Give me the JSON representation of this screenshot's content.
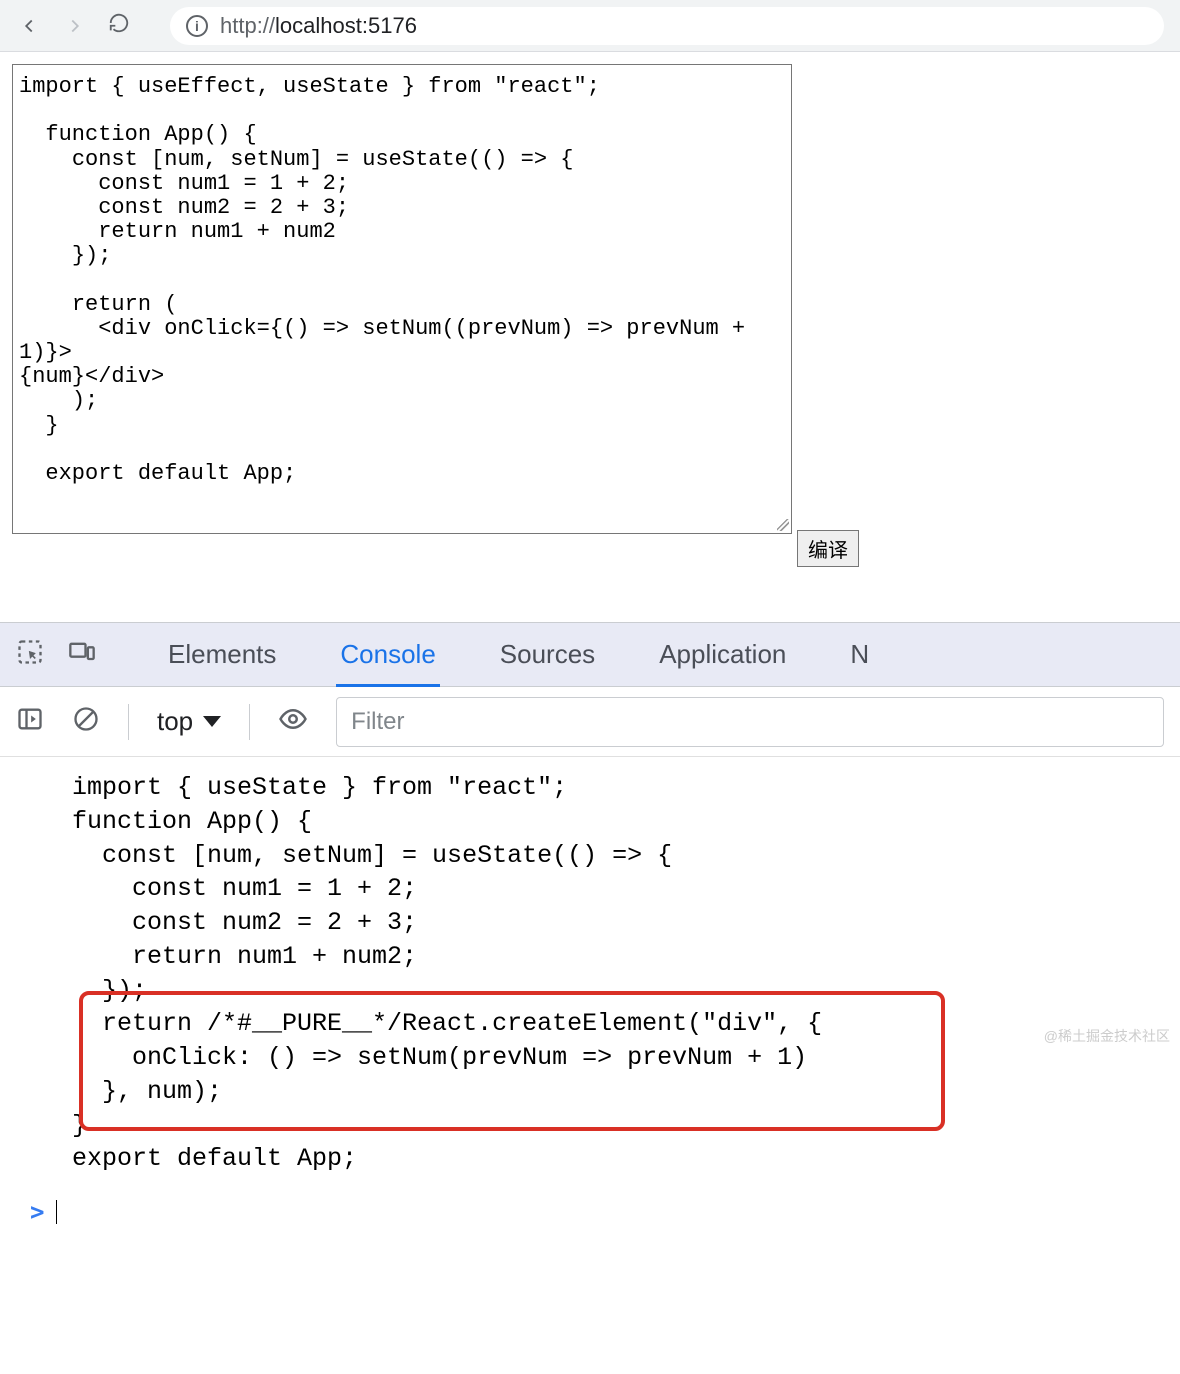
{
  "browser": {
    "url_scheme": "http://",
    "url_rest": "localhost:5176"
  },
  "page": {
    "compile_button": "编译",
    "code": "import { useEffect, useState } from \"react\";\n\n  function App() {\n    const [num, setNum] = useState(() => {\n      const num1 = 1 + 2;\n      const num2 = 2 + 3;\n      return num1 + num2\n    });\n\n    return (\n      <div onClick={() => setNum((prevNum) => prevNum + 1)}>\n{num}</div>\n    );\n  }\n\n  export default App;"
  },
  "devtools": {
    "tabs": {
      "elements": "Elements",
      "console": "Console",
      "sources": "Sources",
      "application": "Application",
      "network_partial": "N"
    },
    "toolbar": {
      "context": "top",
      "filter_placeholder": "Filter"
    },
    "console_code": "import { useState } from \"react\";\nfunction App() {\n  const [num, setNum] = useState(() => {\n    const num1 = 1 + 2;\n    const num2 = 2 + 3;\n    return num1 + num2;\n  });\n  return /*#__PURE__*/React.createElement(\"div\", {\n    onClick: () => setNum(prevNum => prevNum + 1)\n  }, num);\n}\nexport default App;",
    "prompt": ">"
  },
  "watermark": "@稀土掘金技术社区"
}
